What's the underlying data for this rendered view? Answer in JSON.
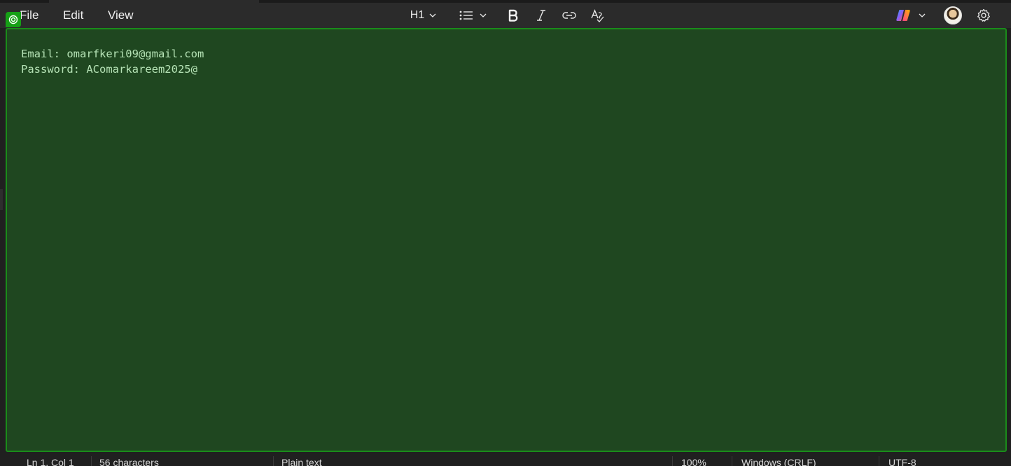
{
  "menu": {
    "file": "File",
    "edit": "Edit",
    "view": "View"
  },
  "toolbar": {
    "heading_label": "H1",
    "icons": [
      "chevron-down-icon",
      "bulleted-list-icon",
      "bold-icon",
      "italic-icon",
      "link-icon",
      "spell-check-icon",
      "copilot-icon",
      "avatar",
      "gear-icon"
    ]
  },
  "editor": {
    "lines": [
      "Email: omarfkeri09@gmail.com",
      "Password: AComarkareem2025@"
    ],
    "background": "#1f4720",
    "border": "#1a8c1a",
    "text_color": "#b6e3b6"
  },
  "status": {
    "position": "Ln 1, Col 1",
    "characters": "56 characters",
    "format": "Plain text",
    "zoom": "100%",
    "line_ending": "Windows (CRLF)",
    "encoding": "UTF-8"
  }
}
